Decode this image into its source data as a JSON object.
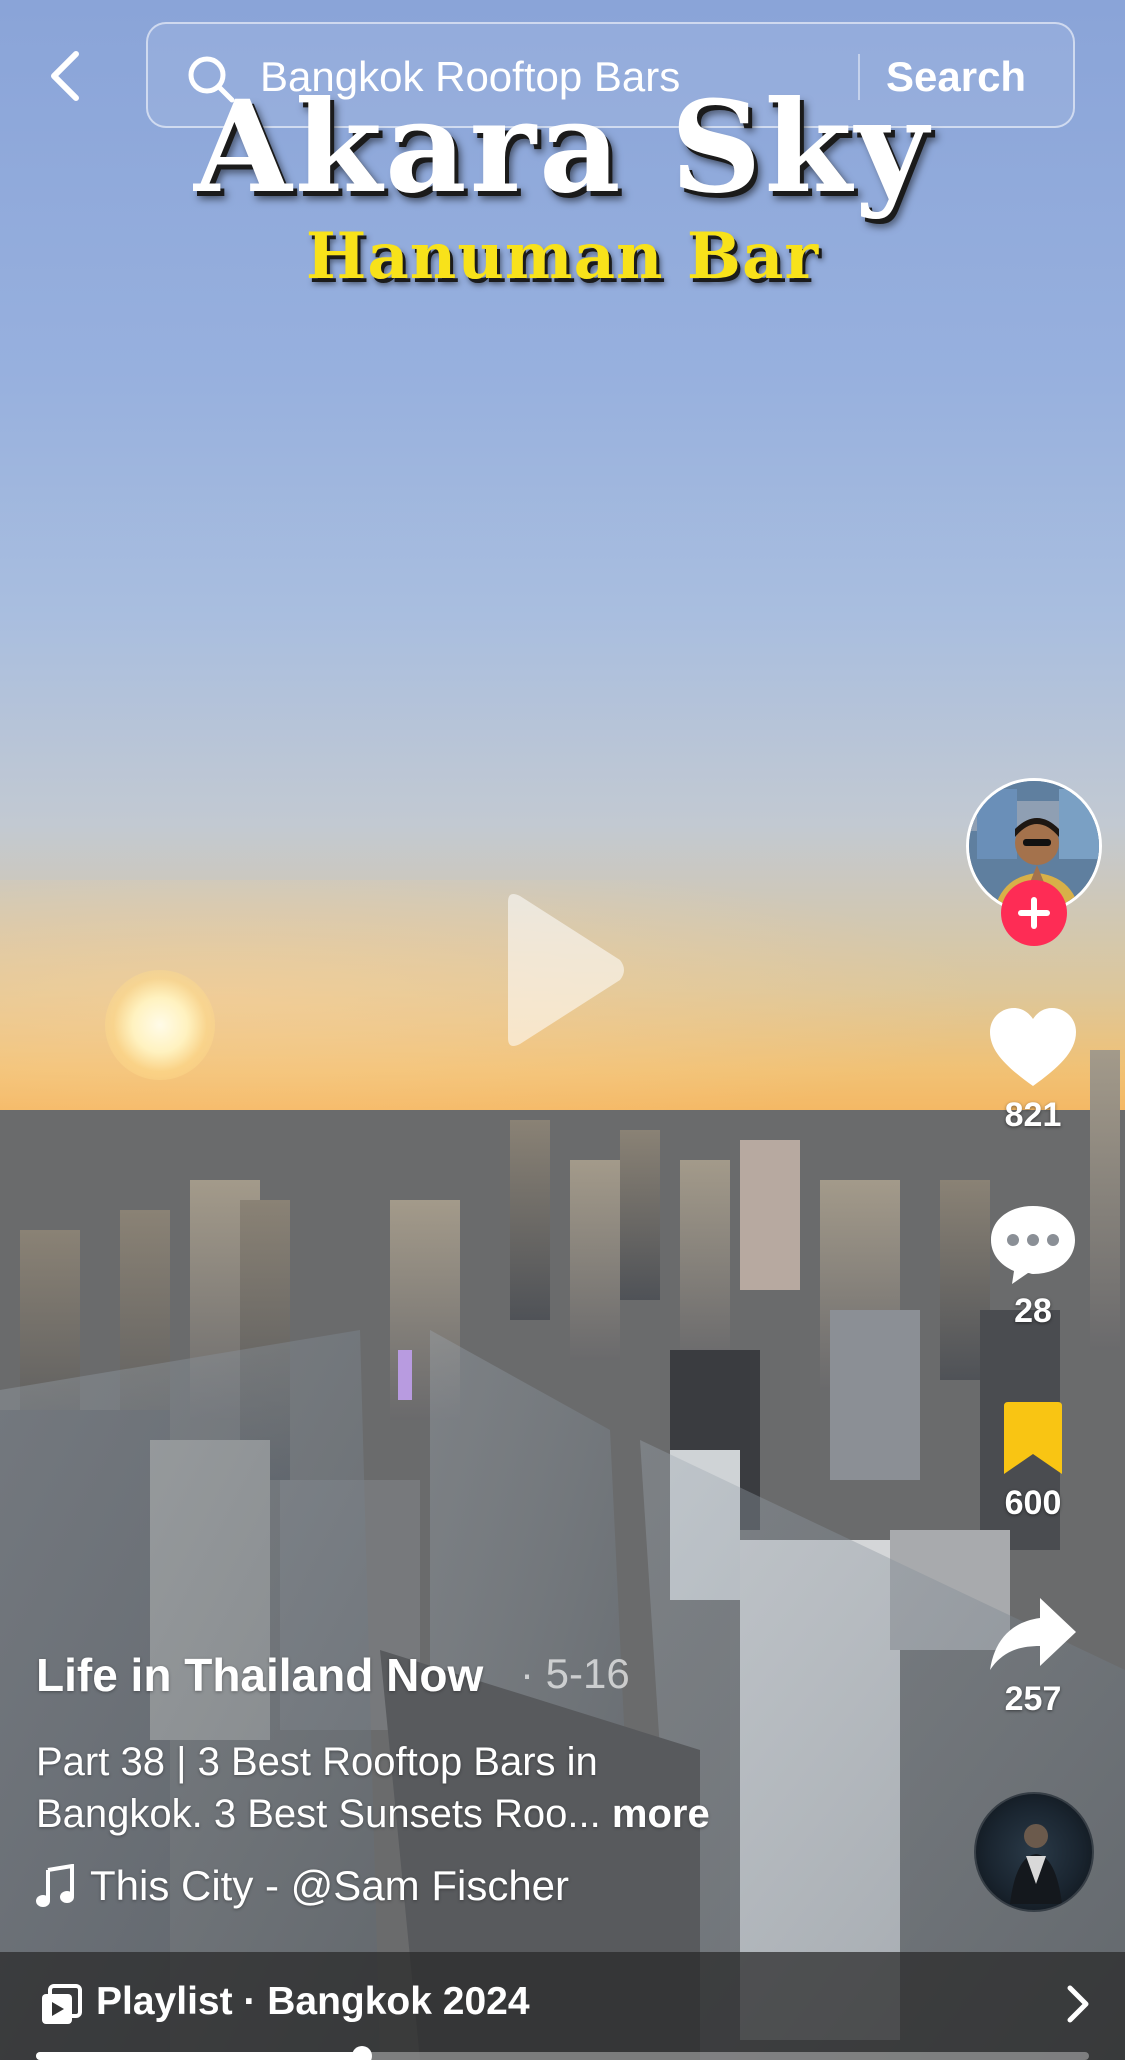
{
  "search": {
    "query": "Bangkok Rooftop Bars",
    "button_label": "Search"
  },
  "video": {
    "title_overlay": "Akara Sky",
    "subtitle_overlay": "Hanuman Bar",
    "state": "paused",
    "progress_fraction": 0.31
  },
  "actions": {
    "likes": "821",
    "comments": "28",
    "saves": "600",
    "shares": "257"
  },
  "post": {
    "author": "Life in Thailand Now",
    "date": "· 5-16",
    "caption_line1": "Part 38 | 3 Best Rooftop Bars in",
    "caption_line2": "Bangkok.  3 Best Sunsets Roo...",
    "more_label": "more",
    "sound": "This City - @Sam Fischer"
  },
  "playlist": {
    "label": "Playlist · Bangkok 2024"
  },
  "colors": {
    "follow_accent": "#fe2c55",
    "save_active": "#f9c513",
    "subtitle_yellow": "#f8e21a"
  },
  "icons": [
    "back-arrow-icon",
    "search-icon",
    "play-icon",
    "plus-icon",
    "heart-icon",
    "comment-icon",
    "bookmark-icon",
    "share-icon",
    "music-note-icon",
    "playlist-icon",
    "chevron-right-icon"
  ]
}
